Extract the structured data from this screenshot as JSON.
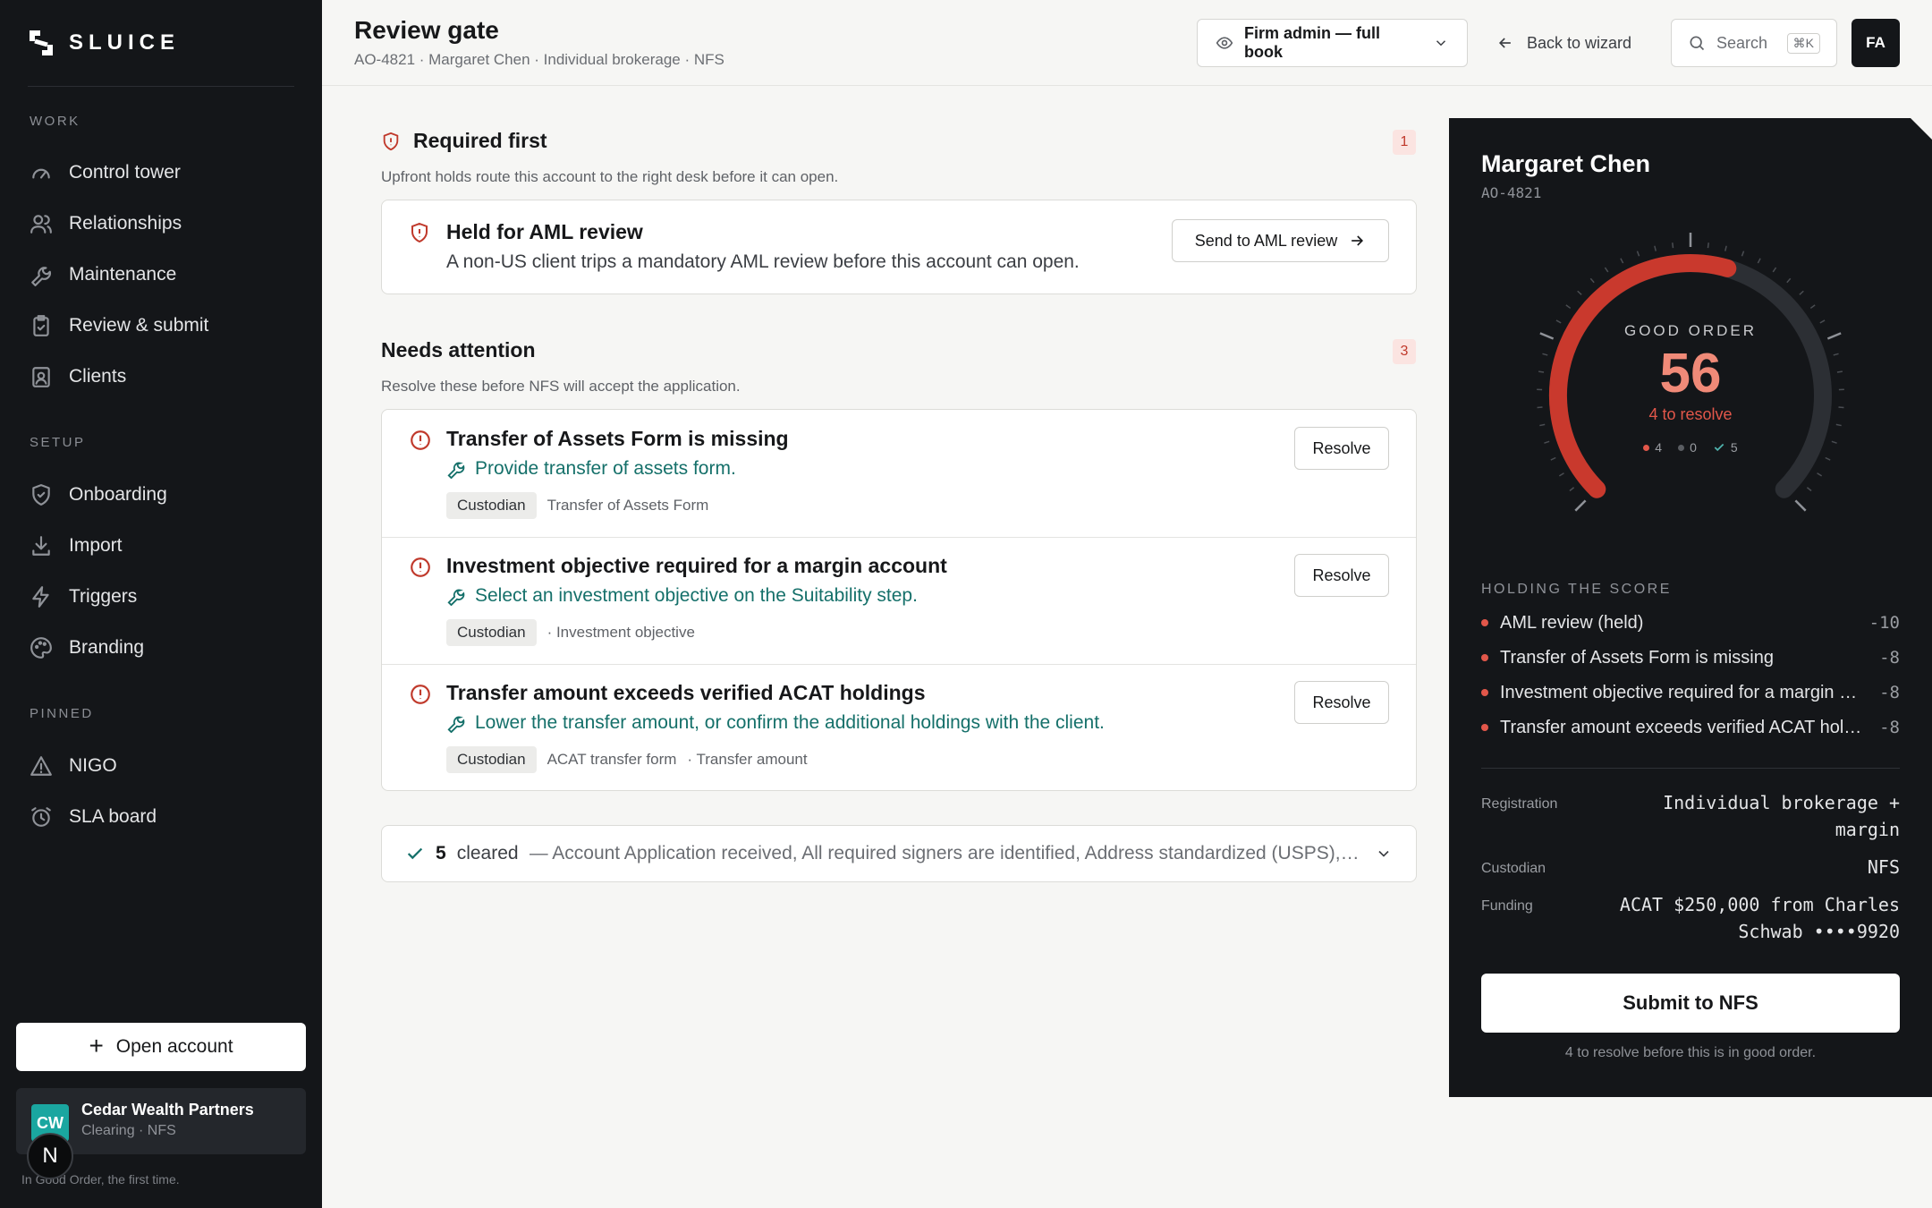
{
  "brand": {
    "name": "SLUICE"
  },
  "sidebar": {
    "sections": {
      "work": "WORK",
      "setup": "SETUP",
      "pinned": "PINNED"
    },
    "work_items": [
      {
        "label": "Control tower",
        "icon": "gauge-icon"
      },
      {
        "label": "Relationships",
        "icon": "users-icon"
      },
      {
        "label": "Maintenance",
        "icon": "wrench-icon"
      },
      {
        "label": "Review & submit",
        "icon": "clipboard-check-icon"
      },
      {
        "label": "Clients",
        "icon": "contact-card-icon"
      }
    ],
    "setup_items": [
      {
        "label": "Onboarding",
        "icon": "shield-check-icon"
      },
      {
        "label": "Import",
        "icon": "download-icon"
      },
      {
        "label": "Triggers",
        "icon": "lightning-icon"
      },
      {
        "label": "Branding",
        "icon": "palette-icon"
      }
    ],
    "pinned_items": [
      {
        "label": "NIGO",
        "icon": "warning-triangle-icon"
      },
      {
        "label": "SLA board",
        "icon": "alarm-clock-icon"
      }
    ],
    "open_account": "Open account",
    "org": {
      "initials": "CW",
      "name": "Cedar Wealth Partners",
      "sub": "Clearing · NFS"
    },
    "n_badge": "N",
    "tagline": "In Good Order, the first time."
  },
  "header": {
    "title": "Review gate",
    "subtitle": "AO-4821 · Margaret Chen · Individual brokerage · NFS",
    "role_select": "Firm admin — full book",
    "back": "Back to wizard",
    "search_placeholder": "Search",
    "search_kbd": "⌘K",
    "avatar": "FA"
  },
  "required": {
    "title": "Required first",
    "count": "1",
    "desc": "Upfront holds route this account to the right desk before it can open.",
    "item": {
      "title": "Held for AML review",
      "desc": "A non-US client trips a mandatory AML review before this account can open.",
      "action": "Send to AML review"
    }
  },
  "attention": {
    "title": "Needs attention",
    "count": "3",
    "desc": "Resolve these before NFS will accept the application.",
    "items": [
      {
        "title": "Transfer of Assets Form is missing",
        "fix": "Provide transfer of assets form.",
        "tag": "Custodian",
        "meta1": "Transfer of Assets Form",
        "meta2": "",
        "action": "Resolve"
      },
      {
        "title": "Investment objective required for a margin account",
        "fix": "Select an investment objective on the Suitability step.",
        "tag": "Custodian",
        "meta1": "",
        "meta2": "· Investment objective",
        "action": "Resolve"
      },
      {
        "title": "Transfer amount exceeds verified ACAT holdings",
        "fix": "Lower the transfer amount, or confirm the additional holdings with the client.",
        "tag": "Custodian",
        "meta1": "ACAT transfer form",
        "meta2": "· Transfer amount",
        "action": "Resolve"
      }
    ]
  },
  "cleared": {
    "count": "5",
    "label": "cleared",
    "list": "— Account Application received, All required signers are identified, Address standardized (USPS), Beneficiary designation on file, Cost basis method selected"
  },
  "panel": {
    "client_name": "Margaret Chen",
    "client_id": "AO-4821",
    "score_label": "GOOD ORDER",
    "score": 56,
    "score_max": 100,
    "score_sub": "4 to resolve",
    "legend": {
      "red": "4",
      "grey": "0",
      "check": "5"
    },
    "hold_title": "HOLDING THE SCORE",
    "holds": [
      {
        "label": "AML review (held)",
        "points": "-10"
      },
      {
        "label": "Transfer of Assets Form is missing",
        "points": "-8"
      },
      {
        "label": "Investment objective required for a margin account",
        "points": "-8"
      },
      {
        "label": "Transfer amount exceeds verified ACAT holdings",
        "points": "-8"
      }
    ],
    "registration_label": "Registration",
    "registration_value": "Individual brokerage + margin",
    "custodian_label": "Custodian",
    "custodian_value": "NFS",
    "funding_label": "Funding",
    "funding_value": "ACAT $250,000 from Charles Schwab ••••9920",
    "submit": "Submit to NFS",
    "submit_note": "4 to resolve before this is in good order."
  },
  "colors": {
    "accent_red": "#c0392b",
    "gauge_red": "#c9392d",
    "teal": "#15706a",
    "dark": "#141619"
  }
}
